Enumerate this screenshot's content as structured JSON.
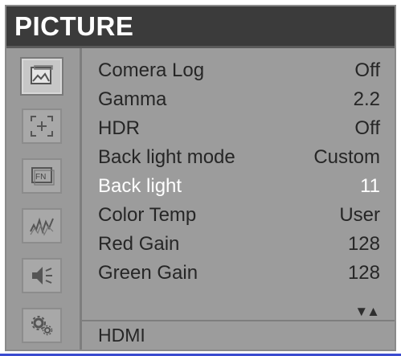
{
  "title": "PICTURE",
  "sidebar": {
    "items": [
      {
        "icon": "picture-icon",
        "active": true
      },
      {
        "icon": "marker-icon",
        "active": false
      },
      {
        "icon": "fn-icon",
        "active": false
      },
      {
        "icon": "waveform-icon",
        "active": false
      },
      {
        "icon": "speaker-icon",
        "active": false
      },
      {
        "icon": "gear-icon",
        "active": false
      }
    ]
  },
  "menu": {
    "items": [
      {
        "label": "Comera Log",
        "value": "Off"
      },
      {
        "label": "Gamma",
        "value": "2.2"
      },
      {
        "label": "HDR",
        "value": "Off"
      },
      {
        "label": "Back light mode",
        "value": "Custom"
      },
      {
        "label": "Back light",
        "value": "11",
        "selected": true
      },
      {
        "label": "Color Temp",
        "value": "User"
      },
      {
        "label": "Red Gain",
        "value": "128"
      },
      {
        "label": "Green Gain",
        "value": "128"
      }
    ],
    "scroll_arrows": "▼▲"
  },
  "footer": {
    "source": "HDMI"
  },
  "colors": {
    "background": "#9c9c9c",
    "title_bar": "#3b3b3b",
    "selected_text": "#ffffff",
    "text": "#262626"
  }
}
